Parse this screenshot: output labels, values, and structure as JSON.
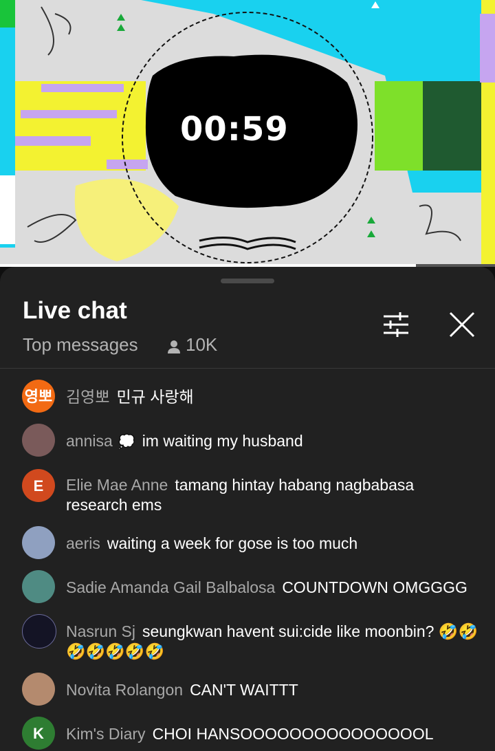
{
  "video": {
    "timer": "00:59",
    "progress_fraction": 0.84
  },
  "chat": {
    "title": "Live chat",
    "mode": "Top messages",
    "viewer_count": "10K",
    "icons": {
      "viewers": "person-icon",
      "filter": "sliders-icon",
      "close": "close-icon"
    },
    "messages": [
      {
        "avatar_text": "영뽀",
        "avatar_color": "#f26a13",
        "author": "김영뽀",
        "text": "민규 사랑해"
      },
      {
        "avatar_text": "",
        "avatar_color": "#7a5a5a",
        "author": "annisa",
        "badge": "💭",
        "text": "im waiting my husband"
      },
      {
        "avatar_text": "E",
        "avatar_color": "#d1491e",
        "author": "Elie Mae Anne",
        "text": "tamang hintay habang nagbabasa research ems"
      },
      {
        "avatar_text": "",
        "avatar_color": "#8fa0c0",
        "author": "aeris",
        "text": "waiting a week for gose is too much"
      },
      {
        "avatar_text": "",
        "avatar_color": "#4f8b83",
        "author": "Sadie Amanda Gail Balbalosa",
        "text": "COUNTDOWN OMGGGG"
      },
      {
        "avatar_text": "",
        "avatar_color": "#141425",
        "author": "Nasrun Sj",
        "text": "seungkwan havent sui:cide like moonbin? 🤣🤣🤣🤣🤣🤣🤣"
      },
      {
        "avatar_text": "",
        "avatar_color": "#b48a6e",
        "author": "Novita Rolangon",
        "text": "CAN'T WAITTT"
      },
      {
        "avatar_text": "K",
        "avatar_color": "#2e7d32",
        "author": "Kim's Diary",
        "text": "CHOI HANSOOOOOOOOOOOOOOOL"
      }
    ]
  }
}
